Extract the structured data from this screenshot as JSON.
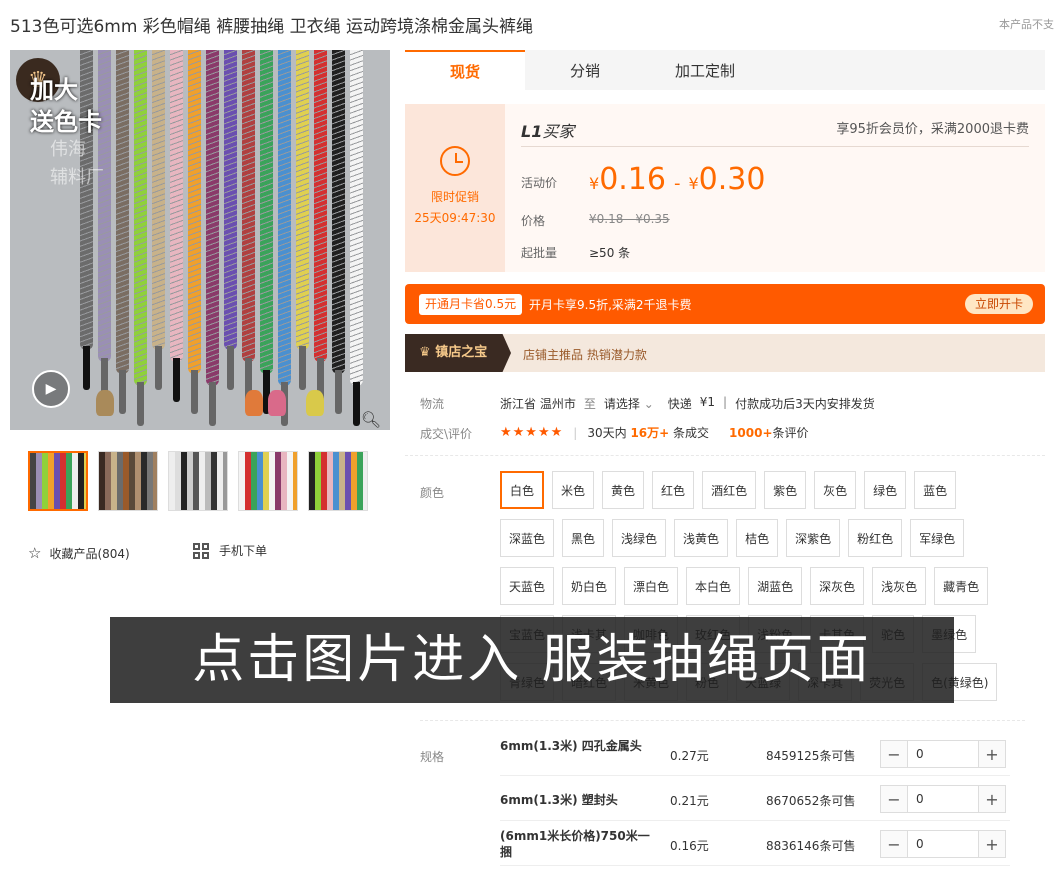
{
  "product": {
    "title": "513色可选6mm 彩色帽绳 裤腰抽绳 卫衣绳 运动跨境涤棉金属头裤绳",
    "unsupported_note": "本产品不支"
  },
  "gallery": {
    "promo_line1": "加大",
    "promo_line2": "送色卡",
    "watermark_line1": "伟海",
    "watermark_line2": "辅料厂",
    "crown_icon": "crown-icon",
    "play_icon": "play-icon",
    "zoom_icon": "zoom-icon",
    "rope_colors": [
      "#6b6b6b",
      "#9a8fb5",
      "#7a6d62",
      "#8fd13a",
      "#c8b28a",
      "#e8b6c0",
      "#f0a02c",
      "#8a3a6a",
      "#6a4fb0",
      "#b04040",
      "#3aa35a",
      "#4a90d0",
      "#e0d050",
      "#d43030",
      "#202020",
      "#f4f4f4"
    ],
    "thumbnail_count": 5,
    "favorite_label": "收藏产品(804)",
    "mobile_label": "手机下单"
  },
  "tabs": [
    {
      "label": "现货",
      "active": true
    },
    {
      "label": "分销",
      "active": false
    },
    {
      "label": "加工定制",
      "active": false
    }
  ],
  "price": {
    "promo_label": "限时促销",
    "promo_timer": "25天09:47:30",
    "buyer_level": "L1",
    "buyer_label": "买家",
    "member_tip": "享95折会员价，采满2000退卡费",
    "activity_label": "活动价",
    "currency": "¥",
    "low": "0.16",
    "high": "0.30",
    "dash": "-",
    "price_label": "价格",
    "original": "¥0.18 - ¥0.35",
    "moq_label": "起批量",
    "moq": "≥50 条"
  },
  "card_bar": {
    "tag": "开通月卡省0.5元",
    "text": "开月卡享9.5折,采满2千退卡费",
    "button": "立即开卡",
    "color": "#ff5a00"
  },
  "treasure": {
    "badge": "镇店之宝",
    "text": "店铺主推品  热销潜力款"
  },
  "logistics": {
    "label": "物流",
    "origin": "浙江省 温州市",
    "to": "至",
    "destination": "请选择",
    "method": "快递",
    "fee": "¥1",
    "note": "付款成功后3天内安排发货"
  },
  "deals": {
    "label": "成交\\评价",
    "stars": "★★★★★",
    "days_text": "30天内",
    "volume": "16万+",
    "volume_suffix": "条成交",
    "reviews": "1000+",
    "reviews_suffix": "条评价"
  },
  "colors": {
    "label": "颜色",
    "options": [
      "白色",
      "米色",
      "黄色",
      "红色",
      "酒红色",
      "紫色",
      "灰色",
      "绿色",
      "蓝色",
      "深蓝色",
      "黑色",
      "浅绿色",
      "浅黄色",
      "桔色",
      "深紫色",
      "粉红色",
      "军绿色",
      "天蓝色",
      "奶白色",
      "漂白色",
      "本白色",
      "湖蓝色",
      "深灰色",
      "浅灰色",
      "藏青色",
      "宝蓝色",
      "浅卡其",
      "咖啡色",
      "玫红色",
      "浅粉色",
      "卡其色",
      "驼色",
      "墨绿色",
      "青绿色",
      "暗红色",
      "米黄色",
      "粉色",
      "天蓝绿",
      "深卡其",
      "荧光色",
      "色(黄绿色)"
    ],
    "selected": "白色"
  },
  "banner": {
    "text": "点击图片进入 服装抽绳页面"
  },
  "specs": {
    "label": "规格",
    "rows": [
      {
        "name": "6mm(1.3米) 四孔金属头",
        "price": "0.27元",
        "stock": "8459125条可售",
        "qty": "0"
      },
      {
        "name": "6mm(1.3米) 塑封头",
        "price": "0.21元",
        "stock": "8670652条可售",
        "qty": "0"
      },
      {
        "name": "(6mm1米长价格)750米一捆",
        "price": "0.16元",
        "stock": "8836146条可售",
        "qty": "0"
      }
    ]
  }
}
